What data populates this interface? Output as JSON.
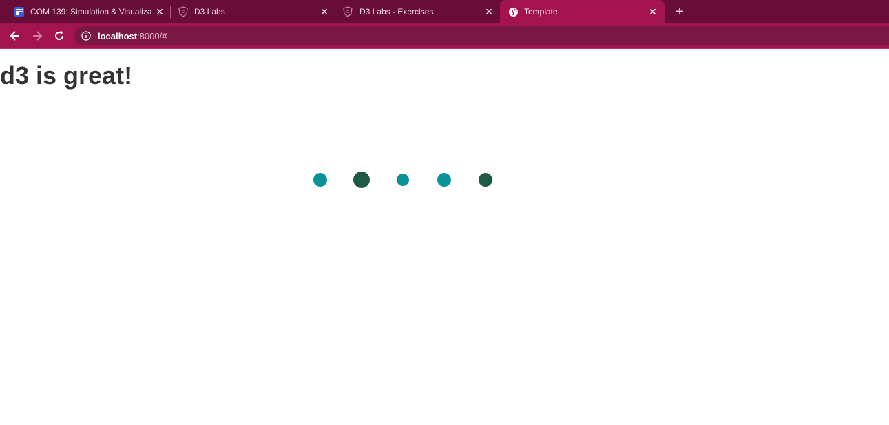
{
  "tabs": [
    {
      "title": "COM 139: Simulation & Visualiza",
      "icon": "calendar-app-icon",
      "active": false
    },
    {
      "title": "D3 Labs",
      "icon": "shield-icon",
      "active": false
    },
    {
      "title": "D3 Labs - Exercises",
      "icon": "shield-icon",
      "active": false
    },
    {
      "title": "Template",
      "icon": "globe-icon",
      "active": true
    }
  ],
  "address": {
    "host": "localhost",
    "rest": ":8000/#"
  },
  "page": {
    "heading": "d3 is great!"
  },
  "circles": [
    {
      "color": "#0a9396",
      "size": "small"
    },
    {
      "color": "#1d5a46",
      "size": "large"
    },
    {
      "color": "#0a9396",
      "size": "smaller"
    },
    {
      "color": "#0a9396",
      "size": "small"
    },
    {
      "color": "#1d5a46",
      "size": "small"
    }
  ],
  "colors": {
    "tabstrip": "#680d37",
    "toolbar": "#a3134e",
    "teal": "#0a9396",
    "dark_green": "#1d5a46"
  }
}
